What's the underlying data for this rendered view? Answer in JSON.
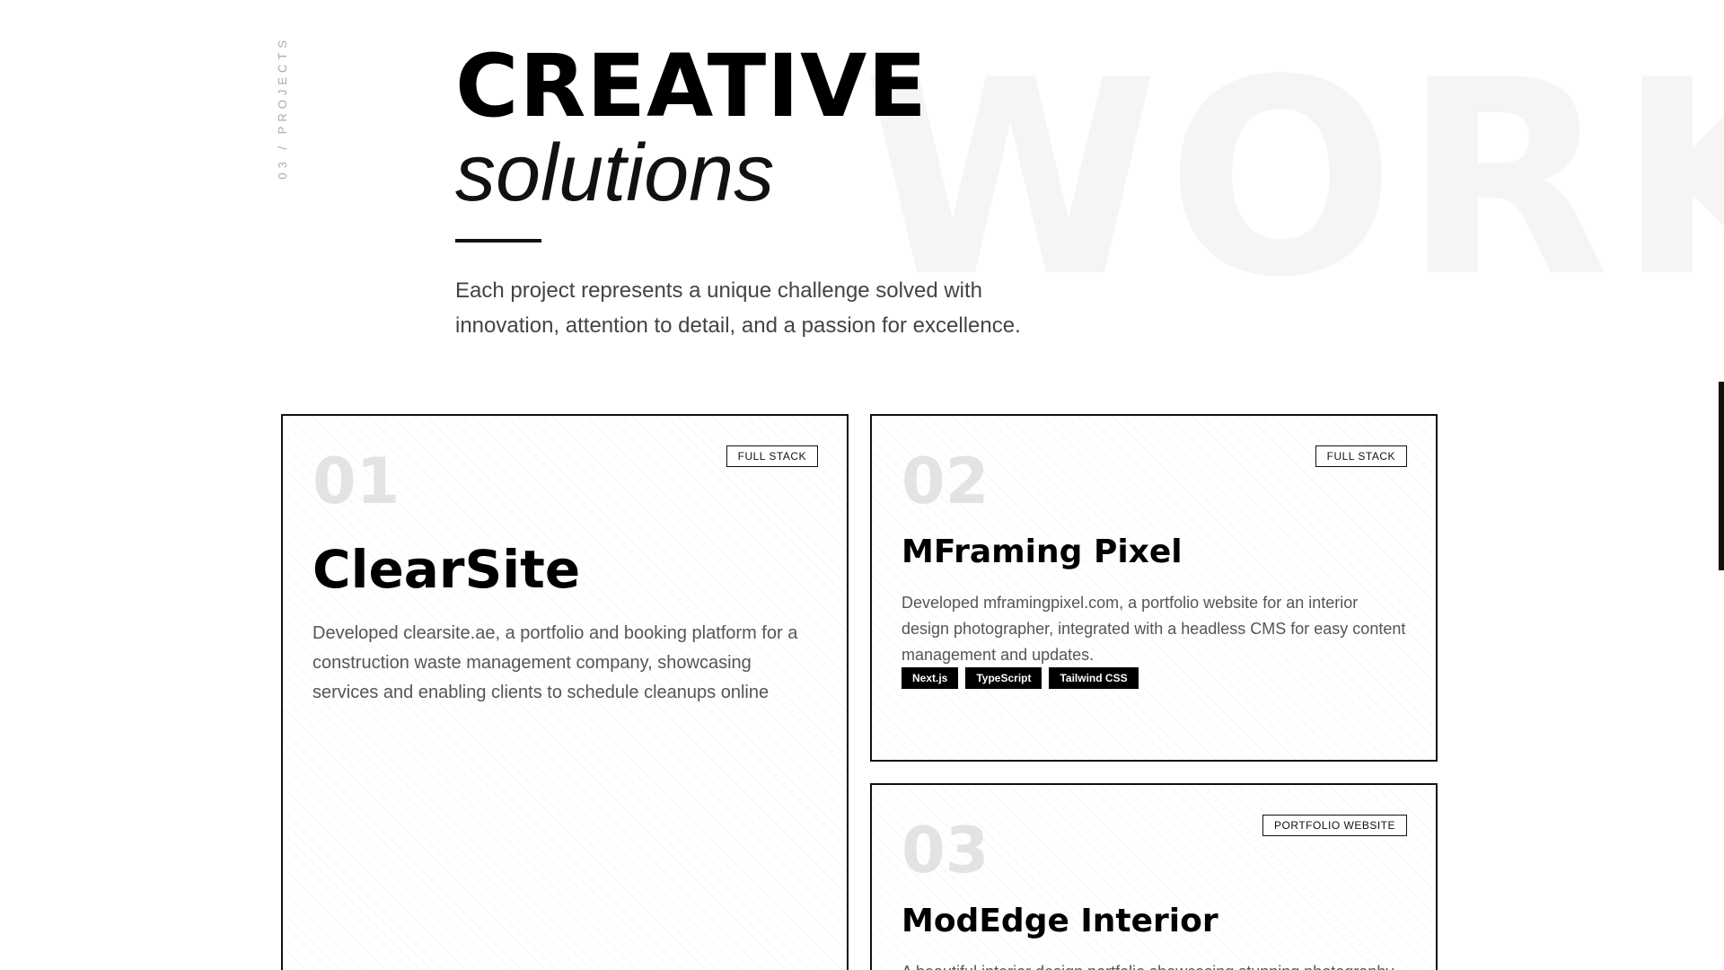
{
  "section": {
    "label": "03 / PROJECTS",
    "background_word": "WORK"
  },
  "heading": {
    "title": "CREATIVE",
    "subtitle": "solutions"
  },
  "intro": {
    "line1": "Each project represents a unique challenge solved with",
    "line2": "innovation, attention to detail, and a passion for excellence."
  },
  "projects": [
    {
      "number": "01",
      "badge": "FULL STACK",
      "title": "ClearSite",
      "description": "Developed clearsite.ae, a portfolio and booking platform for a construction waste management company, showcasing services and enabling clients to schedule cleanups online"
    },
    {
      "number": "02",
      "badge": "FULL STACK",
      "title": "MFraming Pixel",
      "description": "Developed mframingpixel.com, a portfolio website for an interior design photographer, integrated with a headless CMS for easy content management and updates.",
      "tags": [
        "Next.js",
        "TypeScript",
        "Tailwind CSS"
      ]
    },
    {
      "number": "03",
      "badge": "PORTFOLIO WEBSITE",
      "title": "ModEdge Interior",
      "description": "A beautiful interior design portfolio showcasing stunning photography"
    }
  ]
}
